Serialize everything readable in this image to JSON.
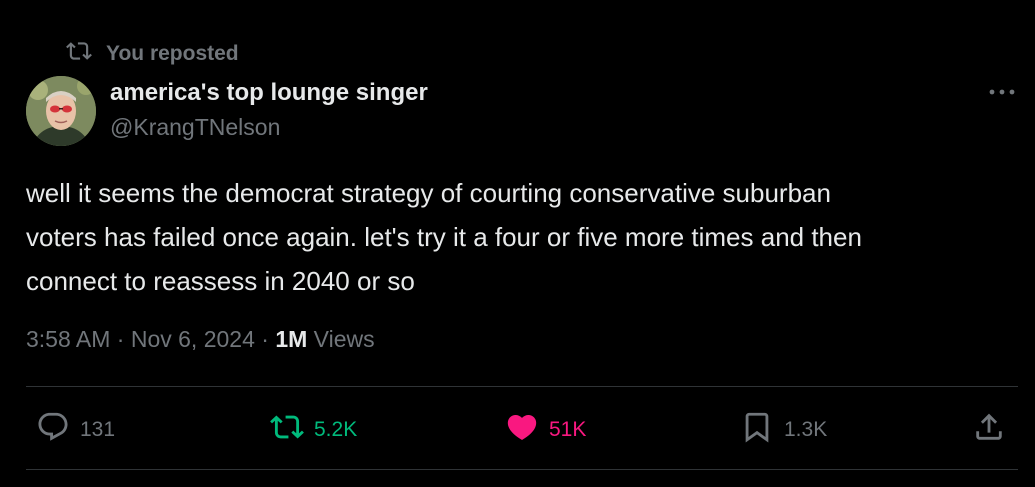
{
  "repost_banner": {
    "text": "You reposted",
    "icon": "repost-icon"
  },
  "author": {
    "name": "america's top lounge singer",
    "handle": "@KrangTNelson",
    "avatar": "profile-photo"
  },
  "more_icon": "more-horizontal-icon",
  "tweet": {
    "lines": [
      "well it seems the democrat strategy of courting conservative suburban",
      "voters has failed once again. let's try it a four or five more times and then",
      "connect to reassess in 2040 or so"
    ]
  },
  "meta": {
    "time": "3:58 AM",
    "separator": "·",
    "date": "Nov 6, 2024",
    "views_count": "1M",
    "views_label": "Views"
  },
  "actions": {
    "reply": {
      "count": "131",
      "icon": "reply-icon"
    },
    "repost": {
      "count": "5.2K",
      "icon": "repost-icon"
    },
    "like": {
      "count": "51K",
      "icon": "heart-icon"
    },
    "bookmark": {
      "count": "1.3K",
      "icon": "bookmark-icon"
    },
    "share": {
      "icon": "share-icon"
    }
  },
  "colors": {
    "background": "#000000",
    "text": "#e7e9ea",
    "muted": "#71767b",
    "repost": "#00ba7c",
    "like": "#f91880",
    "divider": "#2f3336"
  }
}
